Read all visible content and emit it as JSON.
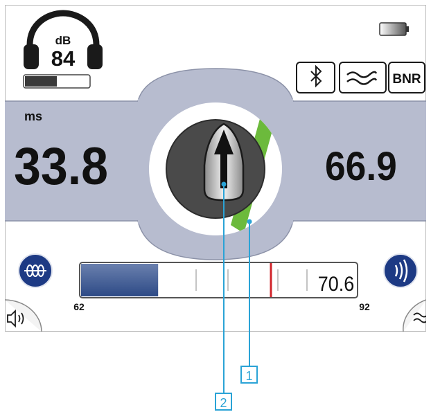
{
  "headphone": {
    "unit": "dB",
    "value": "84",
    "level_fraction": 0.5
  },
  "battery": {
    "level_fraction": 0.55
  },
  "status_buttons": {
    "bluetooth": "bluetooth-icon",
    "filter": "approx-icon",
    "bnr_label": "BNR"
  },
  "delay": {
    "unit": "ms",
    "left_value": "33.8",
    "right_value": "66.9"
  },
  "compass": {
    "arrow": "up-arrow-icon"
  },
  "tuner": {
    "value": "70.6",
    "min_label": "62",
    "max_label": "92",
    "fill_fraction": 0.28
  },
  "buttons": {
    "left": "coil-icon",
    "right": "sound-waves-icon",
    "speaker": "speaker-icon",
    "wave": "approx-icon"
  },
  "callouts": {
    "one": "1",
    "two": "2"
  },
  "colors": {
    "panel": "#b7bccf",
    "navy": "#1d3a84",
    "green": "#6cba3c",
    "red": "#d0232a",
    "dark": "#3c3c3c"
  }
}
